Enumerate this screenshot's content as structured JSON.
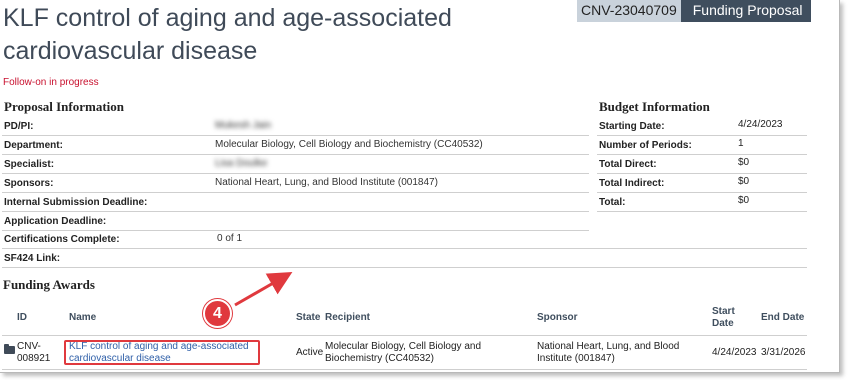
{
  "header": {
    "title": "KLF control of aging and age-associated cardiovascular disease",
    "proposal_id": "CNV-23040709",
    "proposal_type": "Funding Proposal",
    "status_note": "Follow-on in progress"
  },
  "proposal_info": {
    "heading": "Proposal Information",
    "rows": [
      {
        "label": "PD/PI:",
        "value": "Mukesh Jain"
      },
      {
        "label": "Department:",
        "value": "Molecular Biology, Cell Biology and Biochemistry (CC40532)"
      },
      {
        "label": "Specialist:",
        "value": "Lisa Doulke"
      },
      {
        "label": "Sponsors:",
        "value": "National Heart, Lung, and Blood Institute (001847)"
      },
      {
        "label": "Internal Submission Deadline:",
        "value": ""
      },
      {
        "label": "Application Deadline:",
        "value": ""
      },
      {
        "label": "Certifications Complete:",
        "value": "0 of  1"
      },
      {
        "label": "SF424 Link:",
        "value": ""
      }
    ]
  },
  "budget_info": {
    "heading": "Budget Information",
    "rows": [
      {
        "label": "Starting Date:",
        "value": "4/24/2023"
      },
      {
        "label": "Number of Periods:",
        "value": "1"
      },
      {
        "label": "Total Direct:",
        "value": "$0"
      },
      {
        "label": "Total Indirect:",
        "value": "$0"
      },
      {
        "label": "Total:",
        "value": "$0"
      }
    ]
  },
  "funding_awards": {
    "heading": "Funding Awards",
    "columns": {
      "id": "ID",
      "name": "Name",
      "state": "State",
      "recipient": "Recipient",
      "sponsor": "Sponsor",
      "start_date_1": "Start",
      "start_date_2": "Date",
      "end_date": "End Date"
    },
    "rows": [
      {
        "id_1": "CNV-",
        "id_2": "008921",
        "name_1": "KLF control of aging and age-associated",
        "name_2": "cardiovascular disease",
        "state": "Active",
        "recipient_1": "Molecular Biology, Cell Biology and",
        "recipient_2": "Biochemistry (CC40532)",
        "sponsor_1": "National Heart, Lung, and Blood",
        "sponsor_2": "Institute (001847)",
        "start_date": "4/24/2023",
        "end_date": "3/31/2026"
      }
    ]
  },
  "annotation": {
    "step_number": "4",
    "color": "#e0393e"
  }
}
